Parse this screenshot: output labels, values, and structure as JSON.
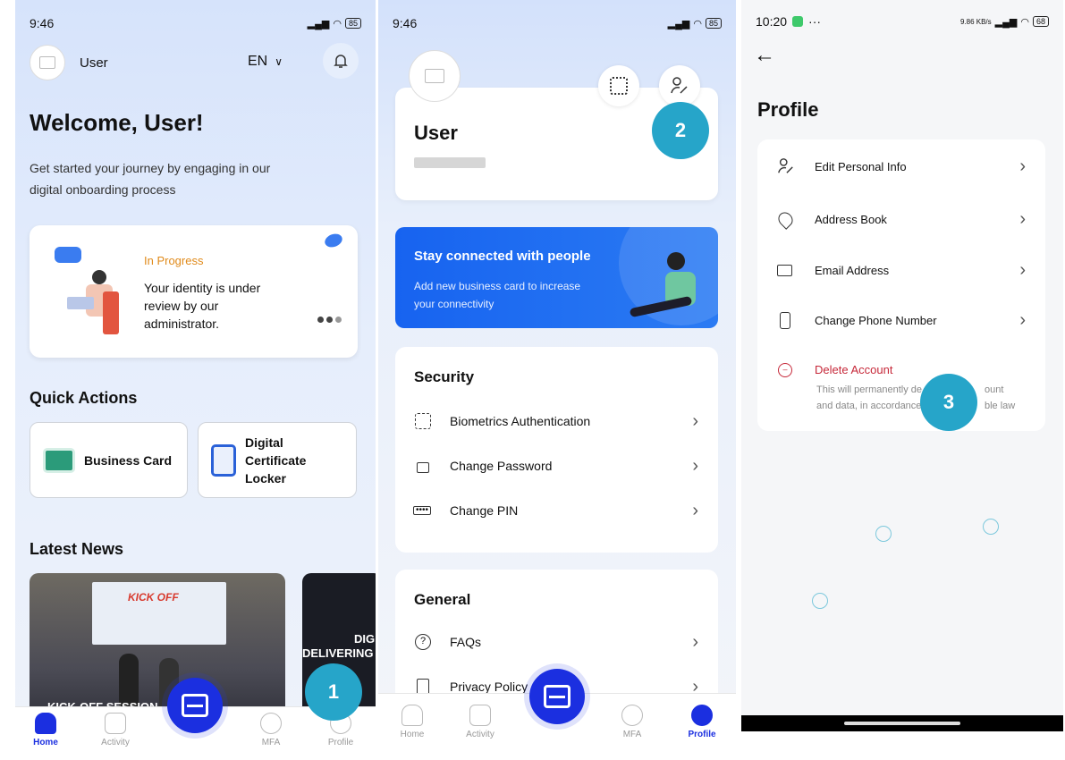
{
  "phone1": {
    "time": "9:46",
    "battery": "85",
    "user_name": "User",
    "language": "EN",
    "welcome": "Welcome, User!",
    "intro": "Get started your journey by engaging in our digital onboarding process",
    "progress_status": "In Progress",
    "progress_text": "Your identity is under review by our administrator.",
    "quick_actions_title": "Quick Actions",
    "quick_actions": [
      "Business Card",
      "Digital Certificate Locker"
    ],
    "latest_news_title": "Latest News",
    "news1_banner": "KICK OFF",
    "news1_caption": "KICK-OFF SESSION",
    "news2_text1": "DIGIT",
    "news2_text2": "DELIVERING",
    "nav": [
      "Home",
      "Activity",
      "MFA",
      "Profile"
    ],
    "step_badge": "1",
    "accent": "#1b2fe0"
  },
  "phone2": {
    "time": "9:46",
    "battery": "85",
    "user_name": "User",
    "step_badge": "2",
    "promo_title": "Stay connected with people",
    "promo_text": "Add new business card to increase your connectivity",
    "security_title": "Security",
    "security_items": [
      "Biometrics Authentication",
      "Change Password",
      "Change PIN"
    ],
    "general_title": "General",
    "general_items": [
      "FAQs",
      "Privacy Policy"
    ],
    "nav": [
      "Home",
      "Activity",
      "MFA",
      "Profile"
    ]
  },
  "phone3": {
    "time": "10:20",
    "status_right": "9.86 KB/s",
    "battery": "68",
    "title": "Profile",
    "items": [
      "Edit Personal Info",
      "Address Book",
      "Email Address",
      "Change Phone Number"
    ],
    "delete_title": "Delete Account",
    "delete_text_line1": "This will permanently de",
    "delete_text_line1b": "ount",
    "delete_text_line2": "and data, in accordance",
    "delete_text_line2b": "ble law",
    "step_badge": "3",
    "danger_color": "#c62839"
  }
}
